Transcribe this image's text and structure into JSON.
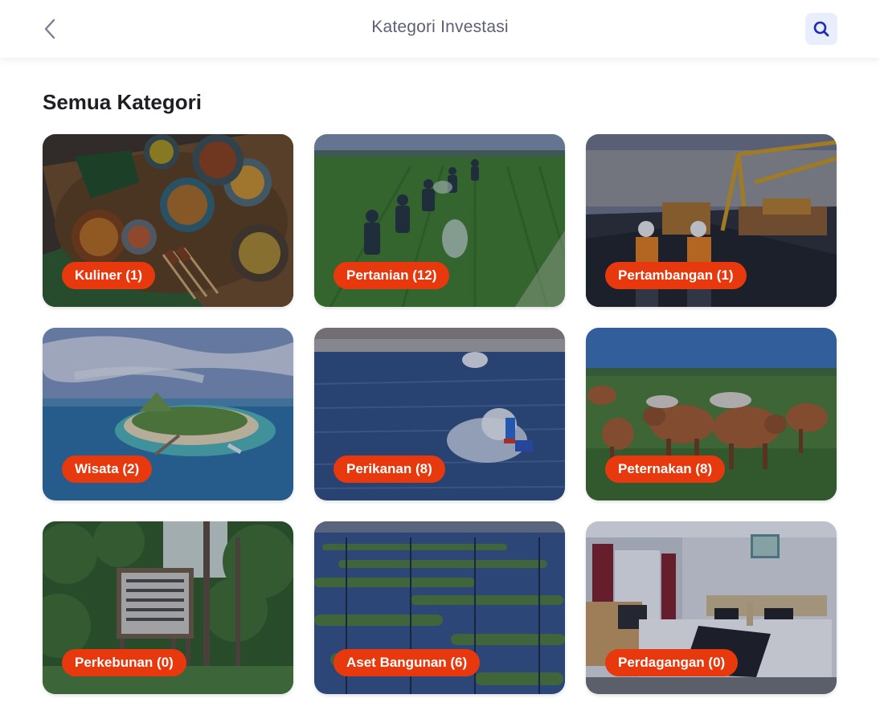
{
  "header": {
    "title": "Kategori Investasi",
    "back_icon": "chevron-left-icon",
    "search_icon": "search-icon"
  },
  "section": {
    "title": "Semua Kategori"
  },
  "categories": [
    {
      "label": "Kuliner (1)",
      "image": "food-dishes-photo"
    },
    {
      "label": "Pertanian (12)",
      "image": "rice-field-photo"
    },
    {
      "label": "Pertambangan (1)",
      "image": "mining-site-photo"
    },
    {
      "label": "Wisata (2)",
      "image": "tropical-island-photo"
    },
    {
      "label": "Perikanan (8)",
      "image": "fish-pond-photo"
    },
    {
      "label": "Peternakan (8)",
      "image": "cattle-field-photo"
    },
    {
      "label": "Perkebunan (0)",
      "image": "plantation-sign-photo"
    },
    {
      "label": "Aset Bangunan (6)",
      "image": "seaweed-farm-photo"
    },
    {
      "label": "Perdagangan (0)",
      "image": "hotel-room-photo"
    }
  ],
  "colors": {
    "accent": "#e8380d",
    "search_bg": "#e8eefb",
    "icon_blue": "#1f2bb0",
    "title_text": "#5d5f78"
  }
}
